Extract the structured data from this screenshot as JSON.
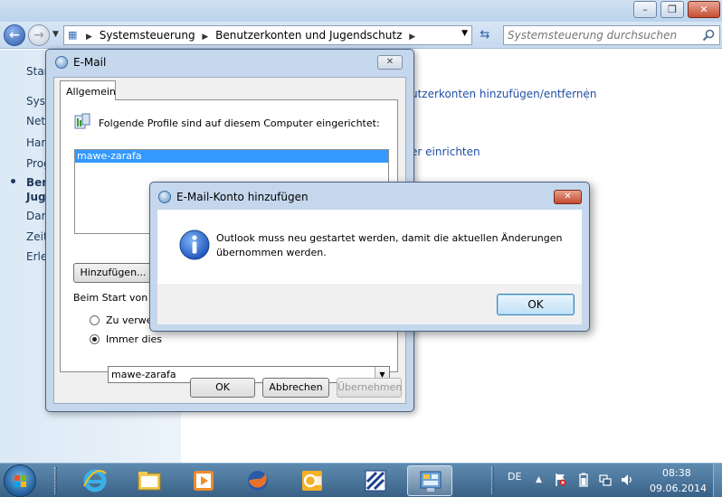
{
  "explorer": {
    "breadcrumb": [
      "Systemsteuerung",
      "Benutzerkonten und Jugendschutz"
    ],
    "search_placeholder": "Systemsteuerung durchsuchen",
    "nav_links": [
      "Star",
      "Syst",
      "Netz",
      "Harc",
      "Prog",
      "Ben",
      "Jugd",
      "Dars",
      "Zeit",
      "Erlei"
    ],
    "task_links": [
      "utzerkonten hinzufügen/entfernen",
      "er einrichten"
    ]
  },
  "email_dialog": {
    "title": "E-Mail",
    "tab": "Allgemein",
    "profiles_label": "Folgende Profile sind auf diesem Computer eingerichtet:",
    "profiles": [
      "mawe-zarafa"
    ],
    "add_button": "Hinzufügen...",
    "startup_label": "Beim Start von Mic",
    "radio_use": "Zu verwen",
    "radio_always": "Immer dies",
    "selected_profile": "mawe-zarafa",
    "ok": "OK",
    "cancel": "Abbrechen",
    "apply": "Übernehmen"
  },
  "message_box": {
    "title": "E-Mail-Konto hinzufügen",
    "line1": "Outlook muss neu gestartet werden, damit die aktuellen Änderungen",
    "line2": "übernommen werden.",
    "ok": "OK",
    "icon": "info-icon"
  },
  "taskbar": {
    "language": "DE",
    "time": "08:38",
    "date": "09.06.2014",
    "apps": [
      "internet-explorer-icon",
      "windows-explorer-icon",
      "media-player-icon",
      "firefox-icon",
      "outlook-icon",
      "zarafa-icon",
      "control-panel-icon"
    ]
  },
  "colors": {
    "accent": "#3399ff",
    "link": "#1f4fa3",
    "taskbar": "#3a6186"
  }
}
